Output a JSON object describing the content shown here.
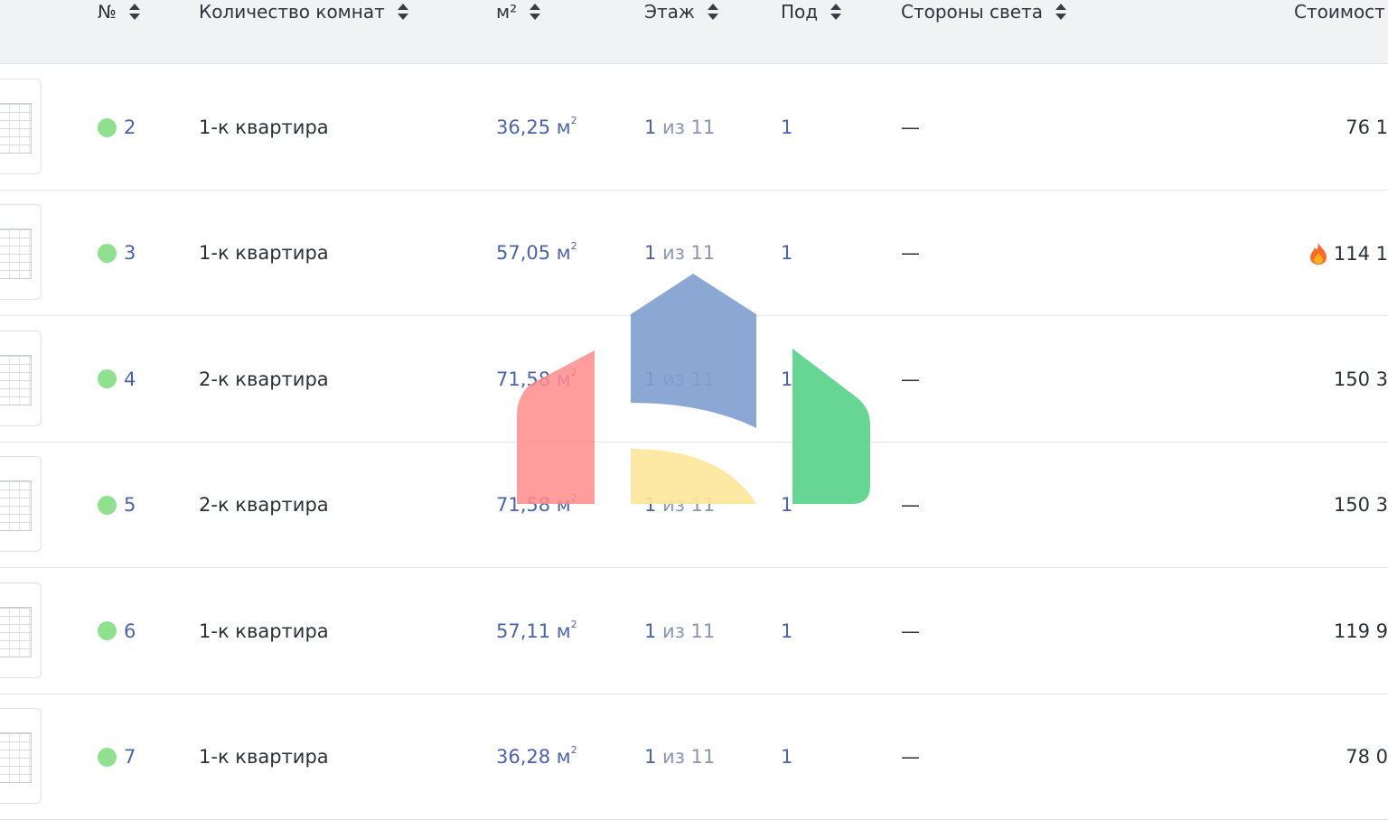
{
  "header": {
    "col_num": "№",
    "col_rooms": "Количество комнат",
    "col_area": "м²",
    "col_floor": "Этаж",
    "col_entrance": "Под",
    "col_sides": "Стороны света",
    "col_price": "Стоимост"
  },
  "rows": [
    {
      "num": "2",
      "rooms": "1-к квартира",
      "area": "36,25 м",
      "floor_a": "1",
      "floor_b": " из 11",
      "entrance": "1",
      "sides": "—",
      "price": "76 1",
      "hot": false
    },
    {
      "num": "3",
      "rooms": "1-к квартира",
      "area": "57,05 м",
      "floor_a": "1",
      "floor_b": " из 11",
      "entrance": "1",
      "sides": "—",
      "price": "114 1",
      "hot": true
    },
    {
      "num": "4",
      "rooms": "2-к квартира",
      "area": "71,58 м",
      "floor_a": "1",
      "floor_b": " из 11",
      "entrance": "1",
      "sides": "—",
      "price": "150 3",
      "hot": false
    },
    {
      "num": "5",
      "rooms": "2-к квартира",
      "area": "71,58 м",
      "floor_a": "1",
      "floor_b": " из 11",
      "entrance": "1",
      "sides": "—",
      "price": "150 3",
      "hot": false
    },
    {
      "num": "6",
      "rooms": "1-к квартира",
      "area": "57,11 м",
      "floor_a": "1",
      "floor_b": " из 11",
      "entrance": "1",
      "sides": "—",
      "price": "119 9",
      "hot": false
    },
    {
      "num": "7",
      "rooms": "1-к квартира",
      "area": "36,28 м",
      "floor_a": "1",
      "floor_b": " из 11",
      "entrance": "1",
      "sides": "—",
      "price": "78 0",
      "hot": false
    }
  ],
  "area_unit_sup": "2",
  "colors": {
    "status_available": "#8fe08f",
    "link": "#4b63a8",
    "logo_red": "#ff8b8b",
    "logo_blue": "#7e9fcf",
    "logo_yellow": "#fde79a",
    "logo_green": "#57d18a"
  }
}
